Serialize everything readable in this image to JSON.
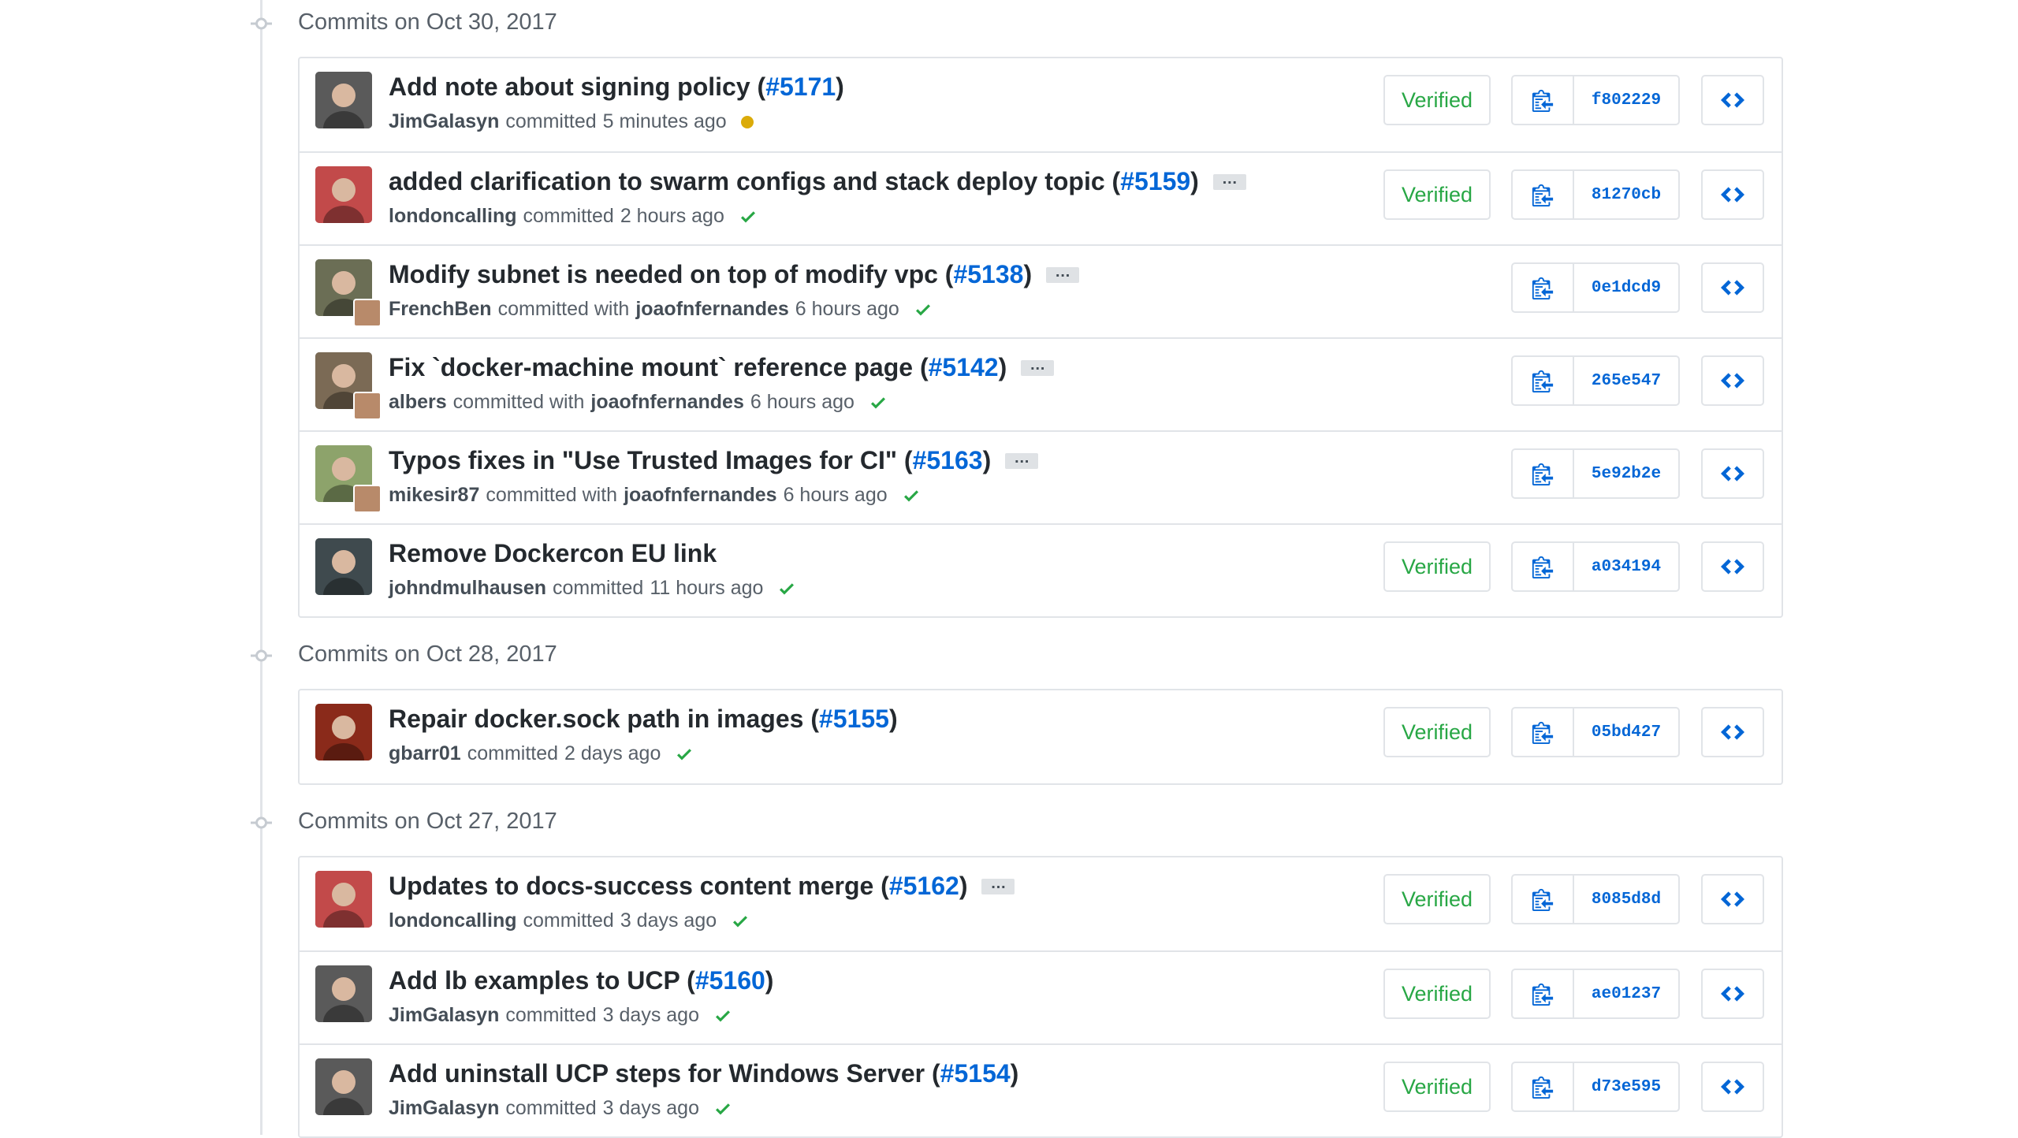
{
  "groups": [
    {
      "title": "Commits on Oct 30, 2017",
      "commits": [
        {
          "message": "Add note about signing policy (",
          "pr": "#5171",
          "close": ")",
          "has_ellipsis": false,
          "author": "JimGalasyn",
          "coauthor": "",
          "time": "5 minutes ago",
          "status": "pending",
          "verified": "Verified",
          "sha": "f802229",
          "avatar_color": "#5a5a5a"
        },
        {
          "message": "added clarification to swarm configs and stack deploy topic (",
          "pr": "#5159",
          "close": ")",
          "has_ellipsis": true,
          "author": "londoncalling",
          "coauthor": "",
          "time": "2 hours ago",
          "status": "success",
          "verified": "Verified",
          "sha": "81270cb",
          "avatar_color": "#c24a4a"
        },
        {
          "message": "Modify subnet is needed on top of modify vpc (",
          "pr": "#5138",
          "close": ")",
          "has_ellipsis": true,
          "author": "FrenchBen",
          "coauthor": "joaofnfernandes",
          "time": "6 hours ago",
          "status": "success",
          "verified": "",
          "sha": "0e1dcd9",
          "avatar_color": "#6b6e55"
        },
        {
          "message": "Fix `docker-machine mount` reference page (",
          "pr": "#5142",
          "close": ")",
          "has_ellipsis": true,
          "author": "albers",
          "coauthor": "joaofnfernandes",
          "time": "6 hours ago",
          "status": "success",
          "verified": "",
          "sha": "265e547",
          "avatar_color": "#7b6a55"
        },
        {
          "message": "Typos fixes in \"Use Trusted Images for CI\" (",
          "pr": "#5163",
          "close": ")",
          "has_ellipsis": true,
          "author": "mikesir87",
          "coauthor": "joaofnfernandes",
          "time": "6 hours ago",
          "status": "success",
          "verified": "",
          "sha": "5e92b2e",
          "avatar_color": "#8da36b"
        },
        {
          "message": "Remove Dockercon EU link",
          "pr": "",
          "close": "",
          "has_ellipsis": false,
          "author": "johndmulhausen",
          "coauthor": "",
          "time": "11 hours ago",
          "status": "success",
          "verified": "Verified",
          "sha": "a034194",
          "avatar_color": "#3f4a4e"
        }
      ]
    },
    {
      "title": "Commits on Oct 28, 2017",
      "commits": [
        {
          "message": "Repair docker.sock path in images (",
          "pr": "#5155",
          "close": ")",
          "has_ellipsis": false,
          "author": "gbarr01",
          "coauthor": "",
          "time": "2 days ago",
          "status": "success",
          "verified": "Verified",
          "sha": "05bd427",
          "avatar_color": "#8a2a1a"
        }
      ]
    },
    {
      "title": "Commits on Oct 27, 2017",
      "commits": [
        {
          "message": "Updates to docs-success content merge (",
          "pr": "#5162",
          "close": ")",
          "has_ellipsis": true,
          "author": "londoncalling",
          "coauthor": "",
          "time": "3 days ago",
          "status": "success",
          "verified": "Verified",
          "sha": "8085d8d",
          "avatar_color": "#c24a4a"
        },
        {
          "message": "Add lb examples to UCP (",
          "pr": "#5160",
          "close": ")",
          "has_ellipsis": false,
          "author": "JimGalasyn",
          "coauthor": "",
          "time": "3 days ago",
          "status": "success",
          "verified": "Verified",
          "sha": "ae01237",
          "avatar_color": "#5a5a5a"
        },
        {
          "message": "Add uninstall UCP steps for Windows Server (",
          "pr": "#5154",
          "close": ")",
          "has_ellipsis": false,
          "author": "JimGalasyn",
          "coauthor": "",
          "time": "3 days ago",
          "status": "success",
          "verified": "Verified",
          "sha": "d73e595",
          "avatar_color": "#5a5a5a"
        }
      ]
    }
  ],
  "labels": {
    "committed": "committed",
    "committed_with": "committed with",
    "ellipsis": "…"
  },
  "colors": {
    "link": "#0366d6",
    "success": "#28a745",
    "pending": "#dbab09",
    "border": "#e1e4e8"
  }
}
